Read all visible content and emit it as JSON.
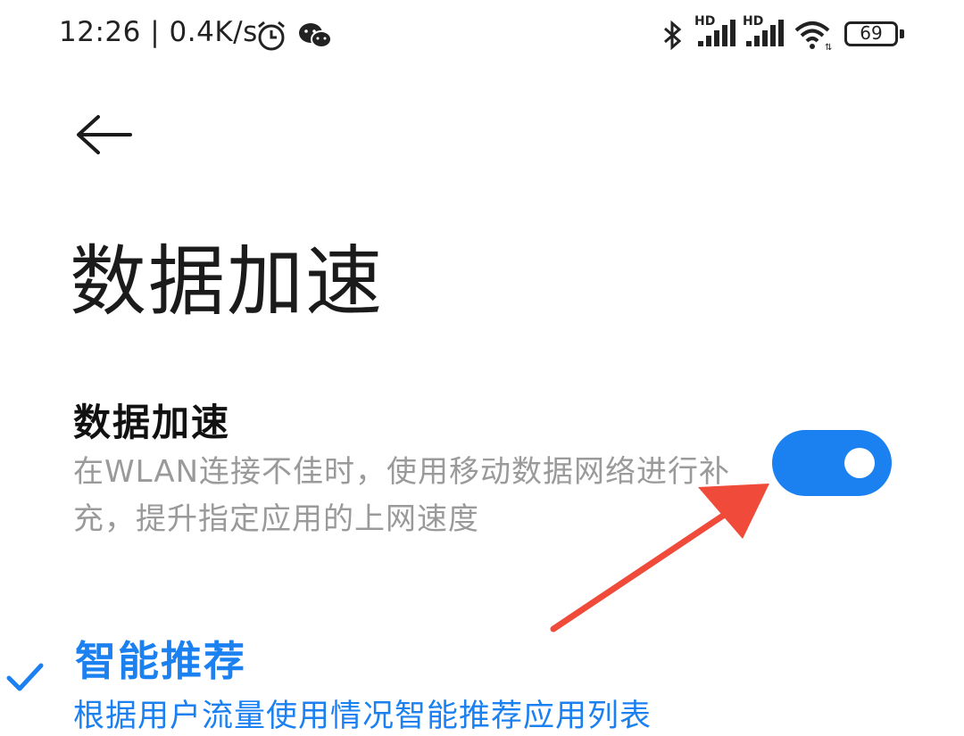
{
  "status_bar": {
    "time": "12:26",
    "separator": "|",
    "net_speed": "0.4K/s",
    "icons": [
      "alarm-icon",
      "wechat-icon",
      "bluetooth-icon",
      "hd-signal-icon",
      "hd-signal-icon",
      "wifi-icon",
      "battery-icon"
    ],
    "signal_badge": "HD",
    "battery_level": "69"
  },
  "header": {
    "back_icon": "back-arrow-icon",
    "title": "数据加速"
  },
  "setting": {
    "title": "数据加速",
    "description": "在WLAN连接不佳时，使用移动数据网络进行补充，提升指定应用的上网速度",
    "toggle_on": true,
    "accent_color": "#1b80f0"
  },
  "option": {
    "selected": true,
    "check_icon": "check-icon",
    "title": "智能推荐",
    "description": "根据用户流量使用情况智能推荐应用列表"
  },
  "annotation": {
    "arrow_icon": "red-arrow-icon",
    "color": "#f04a3a"
  }
}
